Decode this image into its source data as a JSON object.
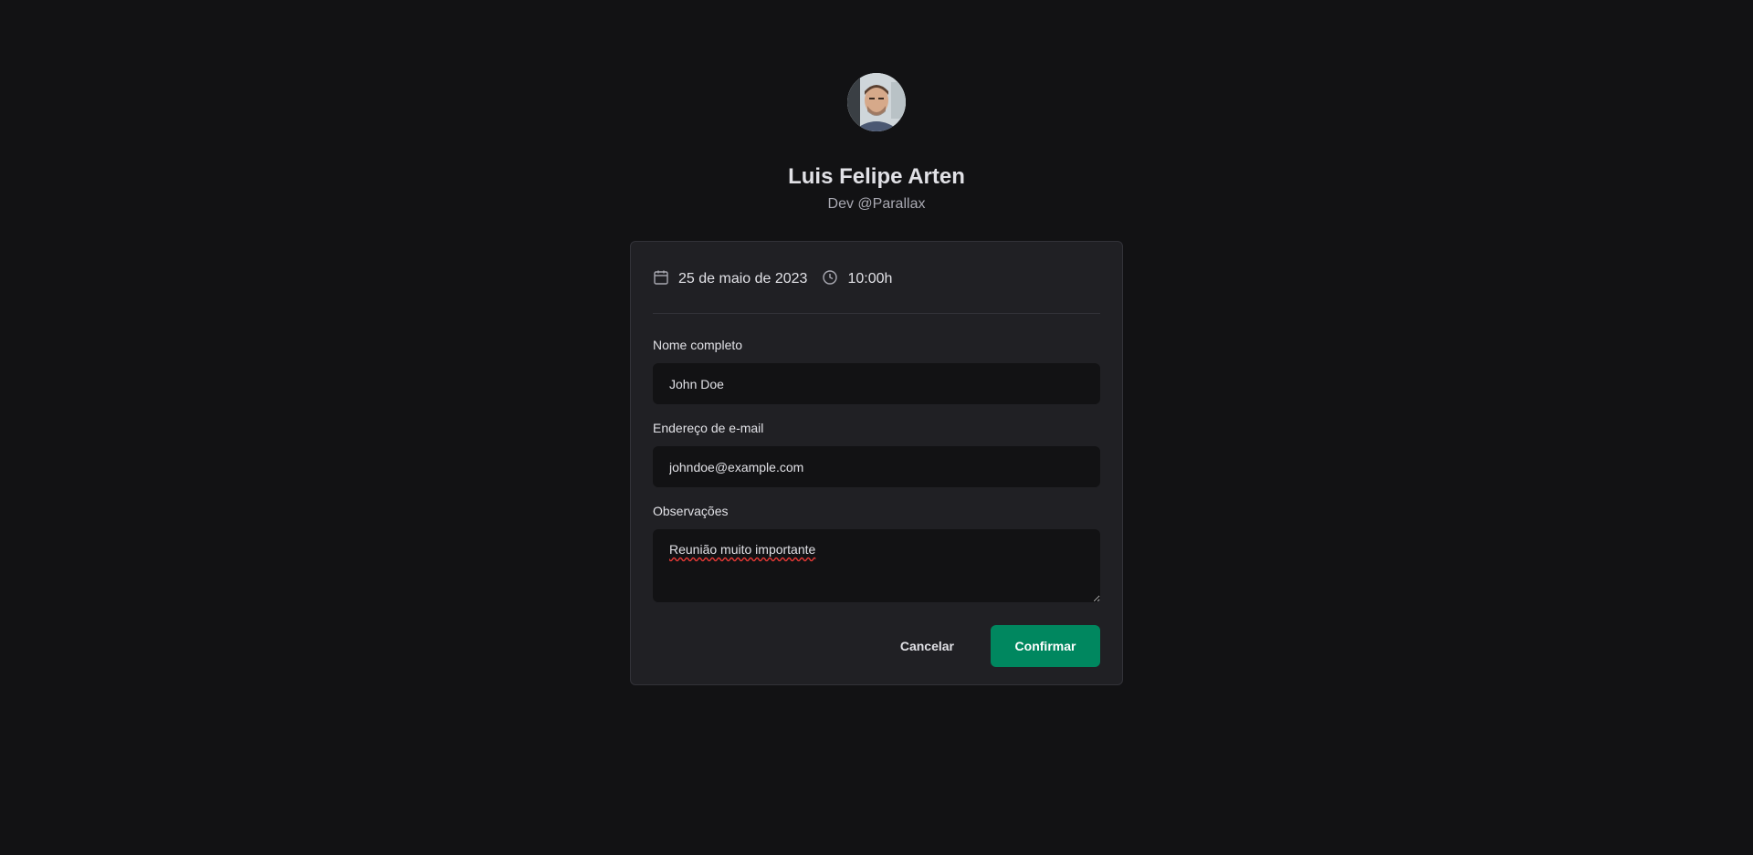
{
  "profile": {
    "name": "Luis Felipe Arten",
    "role": "Dev @Parallax"
  },
  "schedule": {
    "date": "25 de maio de 2023",
    "time": "10:00h",
    "date_icon": "calendar-icon",
    "time_icon": "clock-icon"
  },
  "form": {
    "name_label": "Nome completo",
    "name_value": "John Doe",
    "email_label": "Endereço de e-mail",
    "email_value": "johndoe@example.com",
    "notes_label": "Observações",
    "notes_value": "Reunião muito importante"
  },
  "actions": {
    "cancel_label": "Cancelar",
    "confirm_label": "Confirmar"
  },
  "colors": {
    "background": "#121214",
    "card": "#202024",
    "accent": "#00875f"
  }
}
